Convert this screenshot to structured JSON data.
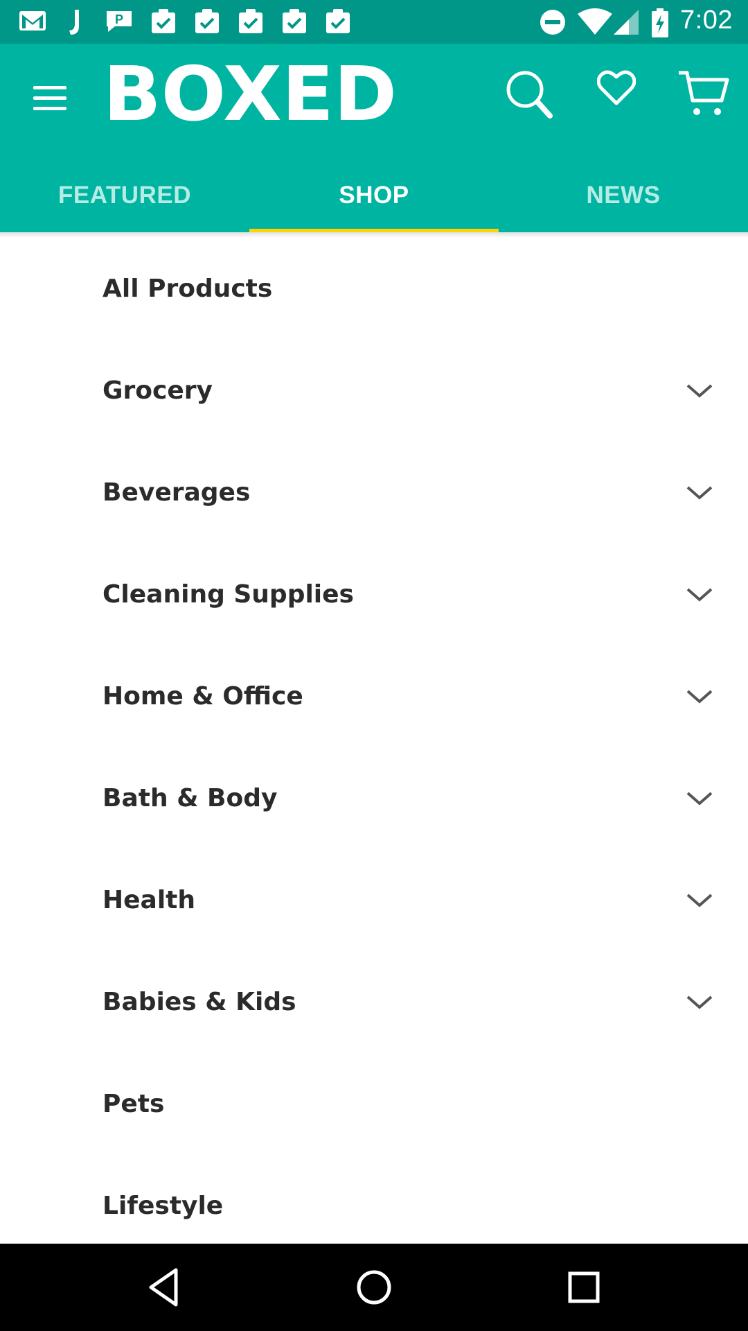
{
  "status_bar": {
    "time": "7:02",
    "left_icons": [
      "gmail-icon",
      "j-app-icon",
      "chat-icon",
      "checklist-icon",
      "checklist-icon",
      "checklist-icon",
      "checklist-icon",
      "checklist-icon"
    ],
    "right_icons": [
      "do-not-disturb-icon",
      "wifi-icon",
      "signal-icon",
      "battery-charging-icon"
    ]
  },
  "header": {
    "logo_text": "BOXED",
    "icons": [
      "menu-icon",
      "search-icon",
      "heart-icon",
      "cart-icon"
    ]
  },
  "tabs": [
    {
      "label": "FEATURED",
      "active": false
    },
    {
      "label": "SHOP",
      "active": true
    },
    {
      "label": "NEWS",
      "active": false
    }
  ],
  "categories": [
    {
      "label": "All Products",
      "expandable": false
    },
    {
      "label": "Grocery",
      "expandable": true
    },
    {
      "label": "Beverages",
      "expandable": true
    },
    {
      "label": "Cleaning Supplies",
      "expandable": true
    },
    {
      "label": "Home & Office",
      "expandable": true
    },
    {
      "label": "Bath & Body",
      "expandable": true
    },
    {
      "label": "Health",
      "expandable": true
    },
    {
      "label": "Babies & Kids",
      "expandable": true
    },
    {
      "label": "Pets",
      "expandable": false
    },
    {
      "label": "Lifestyle",
      "expandable": false
    }
  ],
  "nav_bar": {
    "icons": [
      "back-icon",
      "home-icon",
      "recents-icon"
    ]
  },
  "colors": {
    "status_bar": "#009688",
    "header": "#00b4a2",
    "tab_indicator": "#ffd400",
    "inactive_tab": "#b7ece5",
    "text": "#2b2b2b",
    "chevron": "#555555"
  }
}
